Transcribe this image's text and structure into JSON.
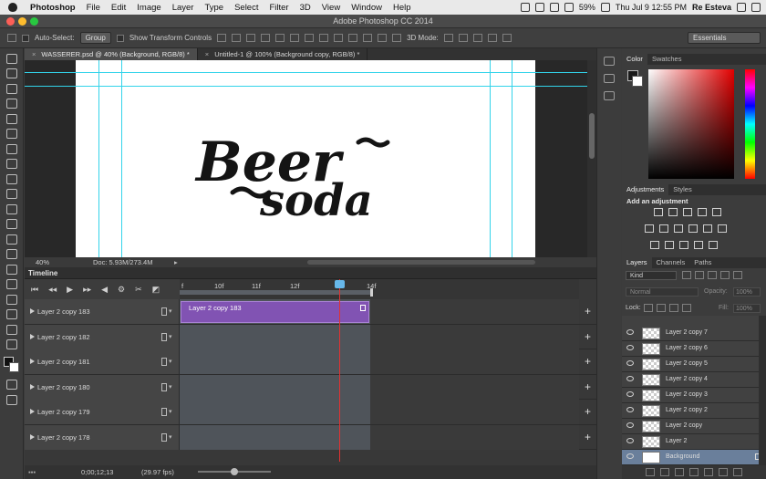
{
  "menubar": {
    "app": "Photoshop",
    "items": [
      "File",
      "Edit",
      "Image",
      "Layer",
      "Type",
      "Select",
      "Filter",
      "3D",
      "View",
      "Window",
      "Help"
    ],
    "battery": "59%",
    "datetime": "Thu Jul 9  12:55 PM",
    "user": "Re Esteva"
  },
  "window": {
    "title": "Adobe Photoshop CC 2014"
  },
  "options": {
    "auto_select_label": "Auto-Select:",
    "auto_select_value": "Group",
    "transform_label": "Show Transform Controls",
    "mode_label": "3D Mode:",
    "workspace": "Essentials"
  },
  "tabs": [
    {
      "label": "WASSERER.psd @ 40% (Background, RGB/8) *",
      "active": true
    },
    {
      "label": "Untitled-1 @ 100% (Background copy, RGB/8) *",
      "active": false
    }
  ],
  "canvas": {
    "artwork_line1": "Beer",
    "artwork_line2": "soda"
  },
  "status": {
    "zoom": "40%",
    "doc": "Doc: 5.93M/273.4M"
  },
  "timeline": {
    "title": "Timeline",
    "ruler": [
      "f",
      "10f",
      "11f",
      "12f",
      "14f"
    ],
    "clip_label": "Layer 2 copy 183",
    "tracks": [
      "Layer 2 copy 183",
      "Layer 2 copy 182",
      "Layer 2 copy 181",
      "Layer 2 copy 180",
      "Layer 2 copy 179",
      "Layer 2 copy 178"
    ],
    "timecode": "0;00;12;13",
    "fps": "(29.97 fps)",
    "playhead_progress": 0.4
  },
  "panels": {
    "color_tabs": [
      "Color",
      "Swatches"
    ],
    "adj_tabs": [
      "Adjustments",
      "Styles"
    ],
    "add_adjustment": "Add an adjustment",
    "layers_tabs": [
      "Layers",
      "Channels",
      "Paths"
    ],
    "filter_kind": "Kind",
    "blend_mode": "Normal",
    "opacity_label": "Opacity:",
    "opacity_value": "100%",
    "lock_label": "Lock:",
    "fill_label": "Fill:",
    "fill_value": "100%",
    "layers": [
      "Layer 2 copy 7",
      "Layer 2 copy 6",
      "Layer 2 copy 5",
      "Layer 2 copy 4",
      "Layer 2 copy 3",
      "Layer 2 copy 2",
      "Layer 2 copy",
      "Layer 2",
      "Background"
    ],
    "selected_layer": "Background"
  }
}
